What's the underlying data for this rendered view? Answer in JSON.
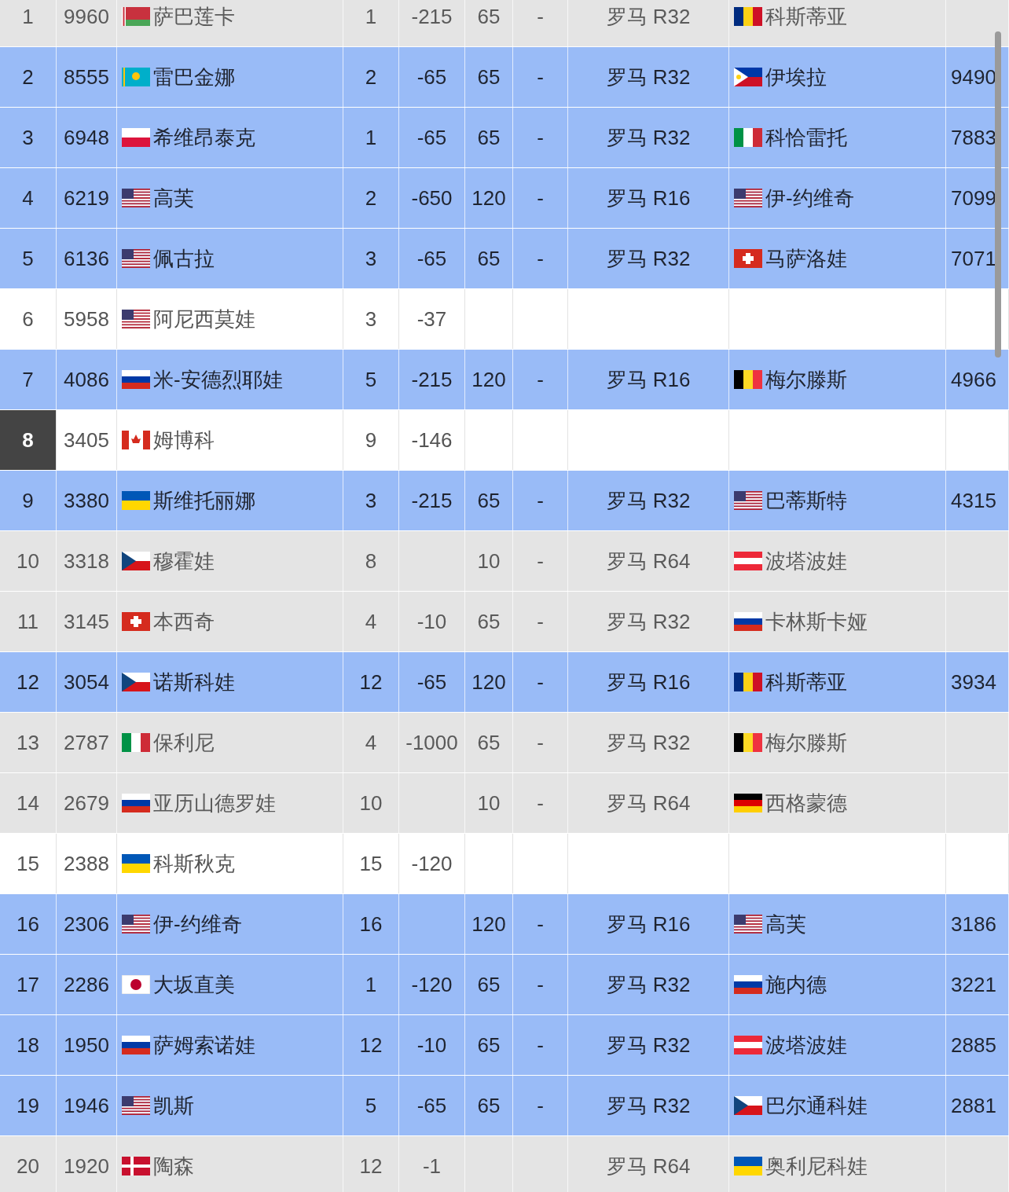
{
  "rows": [
    {
      "kind": "done",
      "highlighted": false,
      "rank": "1",
      "points": "9960",
      "player_flag": {
        "kind": "by"
      },
      "player": "萨巴莲卡",
      "column_4": "1",
      "column_5": "-215",
      "column_6": "65",
      "column_7": "-",
      "event": "罗马 R32",
      "opponent_flag": {
        "kind": "ro"
      },
      "opponent": "科斯蒂亚"
    },
    {
      "kind": "active",
      "highlighted": false,
      "rank": "2",
      "points": "8555",
      "player_flag": {
        "kind": "kz"
      },
      "player": "雷巴金娜",
      "column_4": "2",
      "column_5": "-65",
      "column_6": "65",
      "column_7": "-",
      "event": "罗马 R32",
      "opponent_flag": {
        "kind": "ph"
      },
      "opponent": "伊埃拉",
      "column_10": "9490"
    },
    {
      "kind": "active",
      "highlighted": false,
      "rank": "3",
      "points": "6948",
      "player_flag": {
        "kind": "pl"
      },
      "player": "希维昂泰克",
      "column_4": "1",
      "column_5": "-65",
      "column_6": "65",
      "column_7": "-",
      "event": "罗马 R32",
      "opponent_flag": {
        "kind": "it"
      },
      "opponent": "科恰雷托",
      "column_10": "7883"
    },
    {
      "kind": "active",
      "highlighted": false,
      "rank": "4",
      "points": "6219",
      "player_flag": {
        "kind": "us"
      },
      "player": "高芙",
      "column_4": "2",
      "column_5": "-650",
      "column_6": "120",
      "column_7": "-",
      "event": "罗马 R16",
      "opponent_flag": {
        "kind": "us"
      },
      "opponent": "伊-约维奇",
      "column_10": "7099"
    },
    {
      "kind": "active",
      "highlighted": false,
      "rank": "5",
      "points": "6136",
      "player_flag": {
        "kind": "us"
      },
      "player": "佩古拉",
      "column_4": "3",
      "column_5": "-65",
      "column_6": "65",
      "column_7": "-",
      "event": "罗马 R32",
      "opponent_flag": {
        "kind": "ch"
      },
      "opponent": "马萨洛娃",
      "column_10": "7071"
    },
    {
      "kind": "none",
      "highlighted": false,
      "rank": "6",
      "points": "5958",
      "player_flag": {
        "kind": "us"
      },
      "player": "阿尼西莫娃",
      "column_4": "3",
      "column_5": "-37"
    },
    {
      "kind": "active",
      "highlighted": false,
      "rank": "7",
      "points": "4086",
      "player_flag": {
        "kind": "ru"
      },
      "player": "米-安德烈耶娃",
      "column_4": "5",
      "column_5": "-215",
      "column_6": "120",
      "column_7": "-",
      "event": "罗马 R16",
      "opponent_flag": {
        "kind": "be"
      },
      "opponent": "梅尔滕斯",
      "column_10": "4966"
    },
    {
      "kind": "none",
      "highlighted": true,
      "rank": "8",
      "points": "3405",
      "player_flag": {
        "kind": "ca"
      },
      "player": "姆博科",
      "column_4": "9",
      "column_5": "-146"
    },
    {
      "kind": "active",
      "highlighted": false,
      "rank": "9",
      "points": "3380",
      "player_flag": {
        "kind": "ua"
      },
      "player": "斯维托丽娜",
      "column_4": "3",
      "column_5": "-215",
      "column_6": "65",
      "column_7": "-",
      "event": "罗马 R32",
      "opponent_flag": {
        "kind": "us"
      },
      "opponent": "巴蒂斯特",
      "column_10": "4315"
    },
    {
      "kind": "done",
      "highlighted": false,
      "rank": "10",
      "points": "3318",
      "player_flag": {
        "kind": "cz"
      },
      "player": "穆霍娃",
      "column_4": "8",
      "column_6": "10",
      "column_7": "-",
      "event": "罗马 R64",
      "opponent_flag": {
        "kind": "at"
      },
      "opponent": "波塔波娃"
    },
    {
      "kind": "done",
      "highlighted": false,
      "rank": "11",
      "points": "3145",
      "player_flag": {
        "kind": "ch"
      },
      "player": "本西奇",
      "column_4": "4",
      "column_5": "-10",
      "column_6": "65",
      "column_7": "-",
      "event": "罗马 R32",
      "opponent_flag": {
        "kind": "ru"
      },
      "opponent": "卡林斯卡娅"
    },
    {
      "kind": "active",
      "highlighted": false,
      "rank": "12",
      "points": "3054",
      "player_flag": {
        "kind": "cz"
      },
      "player": "诺斯科娃",
      "column_4": "12",
      "column_5": "-65",
      "column_6": "120",
      "column_7": "-",
      "event": "罗马 R16",
      "opponent_flag": {
        "kind": "ro"
      },
      "opponent": "科斯蒂亚",
      "column_10": "3934"
    },
    {
      "kind": "done",
      "highlighted": false,
      "rank": "13",
      "points": "2787",
      "player_flag": {
        "kind": "it"
      },
      "player": "保利尼",
      "column_4": "4",
      "column_5": "-1000",
      "column_6": "65",
      "column_7": "-",
      "event": "罗马 R32",
      "opponent_flag": {
        "kind": "be"
      },
      "opponent": "梅尔滕斯"
    },
    {
      "kind": "done",
      "highlighted": false,
      "rank": "14",
      "points": "2679",
      "player_flag": {
        "kind": "ru"
      },
      "player": "亚历山德罗娃",
      "column_4": "10",
      "column_6": "10",
      "column_7": "-",
      "event": "罗马 R64",
      "opponent_flag": {
        "kind": "de"
      },
      "opponent": "西格蒙德"
    },
    {
      "kind": "none",
      "highlighted": false,
      "rank": "15",
      "points": "2388",
      "player_flag": {
        "kind": "ua"
      },
      "player": "科斯秋克",
      "column_4": "15",
      "column_5": "-120"
    },
    {
      "kind": "active",
      "highlighted": false,
      "rank": "16",
      "points": "2306",
      "player_flag": {
        "kind": "us"
      },
      "player": "伊-约维奇",
      "column_4": "16",
      "column_6": "120",
      "column_7": "-",
      "event": "罗马 R16",
      "opponent_flag": {
        "kind": "us"
      },
      "opponent": "高芙",
      "column_10": "3186"
    },
    {
      "kind": "active",
      "highlighted": false,
      "rank": "17",
      "points": "2286",
      "player_flag": {
        "kind": "jp"
      },
      "player": "大坂直美",
      "column_4": "1",
      "column_5": "-120",
      "column_6": "65",
      "column_7": "-",
      "event": "罗马 R32",
      "opponent_flag": {
        "kind": "ru"
      },
      "opponent": "施内德",
      "column_10": "3221"
    },
    {
      "kind": "active",
      "highlighted": false,
      "rank": "18",
      "points": "1950",
      "player_flag": {
        "kind": "ru"
      },
      "player": "萨姆索诺娃",
      "column_4": "12",
      "column_5": "-10",
      "column_6": "65",
      "column_7": "-",
      "event": "罗马 R32",
      "opponent_flag": {
        "kind": "at"
      },
      "opponent": "波塔波娃",
      "column_10": "2885"
    },
    {
      "kind": "active",
      "highlighted": false,
      "rank": "19",
      "points": "1946",
      "player_flag": {
        "kind": "us"
      },
      "player": "凯斯",
      "column_4": "5",
      "column_5": "-65",
      "column_6": "65",
      "column_7": "-",
      "event": "罗马 R32",
      "opponent_flag": {
        "kind": "cz"
      },
      "opponent": "巴尔通科娃",
      "column_10": "2881"
    },
    {
      "kind": "done",
      "highlighted": false,
      "rank": "20",
      "points": "1920",
      "player_flag": {
        "kind": "dk"
      },
      "player": "陶森",
      "column_4": "12",
      "column_5": "-1",
      "event": "罗马 R64",
      "opponent_flag": {
        "kind": "ua"
      },
      "opponent": "奥利尼科娃"
    }
  ]
}
